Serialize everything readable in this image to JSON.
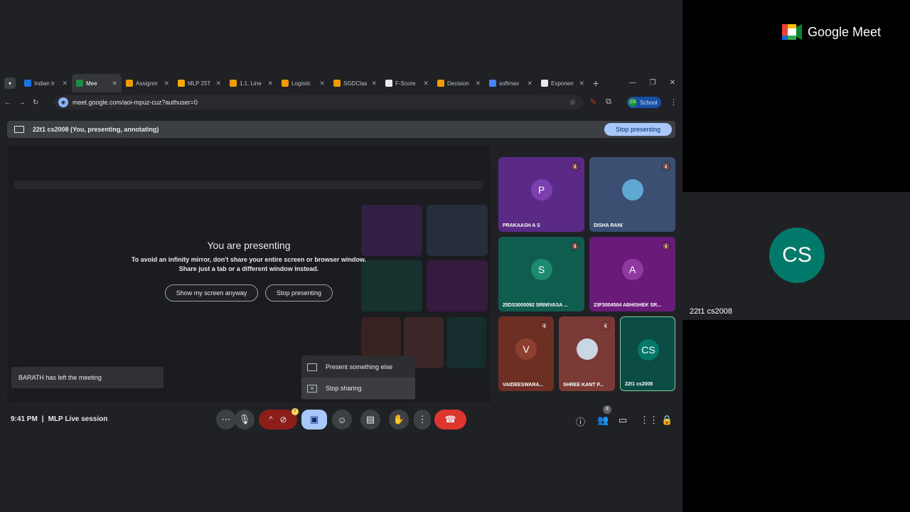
{
  "tabs": [
    {
      "label": "Indian Ir",
      "fav": "#1a73e8"
    },
    {
      "label": "Mee",
      "fav": "#1e8e3e",
      "active": true
    },
    {
      "label": "Assignm",
      "fav": "#f29900"
    },
    {
      "label": "MLP 25T",
      "fav": "#f9ab00"
    },
    {
      "label": "1.1. Line",
      "fav": "#f29900"
    },
    {
      "label": "Logistic",
      "fav": "#f29900"
    },
    {
      "label": "SGDClas",
      "fav": "#f29900"
    },
    {
      "label": "F-Score",
      "fav": "#e8eaed"
    },
    {
      "label": "Decision",
      "fav": "#f29900"
    },
    {
      "label": "softmax",
      "fav": "#4285f4"
    },
    {
      "label": "Exponen",
      "fav": "#e8eaed"
    }
  ],
  "address": {
    "url": "meet.google.com/aoi-mpuz-cuz?authuser=0"
  },
  "profile": {
    "initials": "CS",
    "label": "School"
  },
  "presenting_bar": {
    "text": "22t1 cs2008 (You, presenting, annotating)",
    "stop_label": "Stop presenting"
  },
  "presenting_panel": {
    "title": "You are presenting",
    "message_line1": "To avoid an infinity mirror, don't share your entire screen or browser window.",
    "message_line2": "Share just a tab or a different window instead.",
    "show_anyway_label": "Show my screen anyway",
    "stop_label": "Stop presenting"
  },
  "share_menu": {
    "present_else": "Present something else",
    "stop_sharing": "Stop sharing"
  },
  "toast": {
    "text": "BARATH has left the meeting"
  },
  "participants": [
    {
      "name": "PRAKAASH A S",
      "initial": "P",
      "bg": "#5b2a86",
      "avatar_bg": "#7b3fb0",
      "muted": true
    },
    {
      "name": "DISHA RANI",
      "initial": "",
      "bg": "#3b4f73",
      "avatar_bg": "#5fa8d3",
      "muted": true
    },
    {
      "name": "25DS3000092 SRINIVASA ...",
      "initial": "S",
      "bg": "#0f5d4f",
      "avatar_bg": "#1c8a6e",
      "muted": true
    },
    {
      "name": "23F3004504 ABHISHEK SR...",
      "initial": "A",
      "bg": "#6a1b7a",
      "avatar_bg": "#8e3aa0",
      "muted": true
    },
    {
      "name": "VAIDEESWARA...",
      "initial": "V",
      "bg": "#6d2f24",
      "avatar_bg": "#8d3f30",
      "muted": true
    },
    {
      "name": "SHREE KANT P...",
      "initial": "",
      "bg": "#7a3a36",
      "avatar_bg": "#c9d6e3",
      "muted": true
    },
    {
      "name": "22t1 cs2008",
      "initial": "CS",
      "bg": "#0b4d44",
      "avatar_bg": "#00796b",
      "muted": false
    }
  ],
  "meeting": {
    "time": "9:41 PM",
    "separator": "|",
    "title": "MLP Live session",
    "people_count": "8"
  },
  "brand": {
    "name": "Google Meet"
  },
  "self_view": {
    "initials": "CS",
    "name": "22t1 cs2008"
  },
  "colors": {
    "accent": "#a8c7fa",
    "end_call": "#dc362e",
    "self_tile_border": "#81c995"
  }
}
